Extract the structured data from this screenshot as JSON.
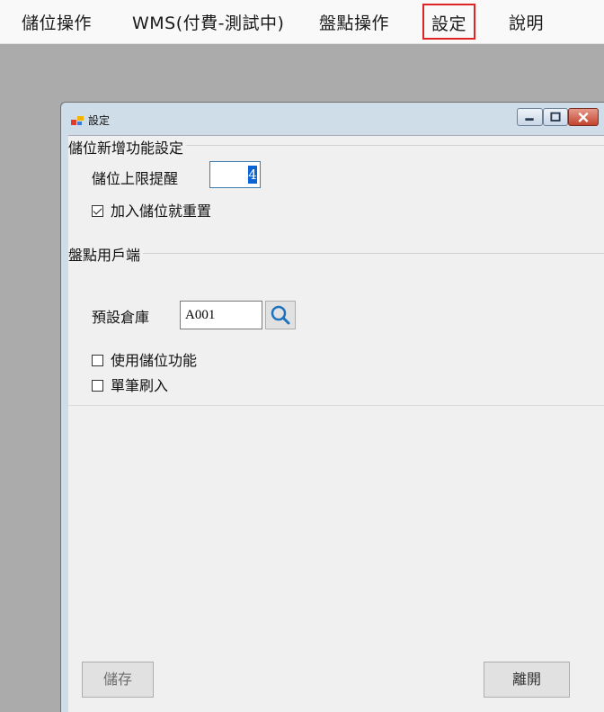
{
  "menubar": {
    "items": [
      {
        "label": "儲位操作"
      },
      {
        "label": "WMS(付費-測試中)"
      },
      {
        "label": "盤點操作"
      },
      {
        "label": "設定",
        "selected": true
      },
      {
        "label": "說明"
      }
    ]
  },
  "window": {
    "title": "設定",
    "icon": "app-icon",
    "controls": [
      "minimize-icon",
      "maximize-icon",
      "close-icon"
    ]
  },
  "storage_group": {
    "title": "儲位新增功能設定",
    "limit_label": "儲位上限提醒",
    "limit_value": "4",
    "reset_checkbox": {
      "label": "加入儲位就重置",
      "checked": true
    }
  },
  "client_group": {
    "title": "盤點用戶端",
    "warehouse_label": "預設倉庫",
    "warehouse_value": "A001",
    "search_icon": "search-icon",
    "use_location_checkbox": {
      "label": "使用儲位功能",
      "checked": false
    },
    "single_scan_checkbox": {
      "label": "單筆刷入",
      "checked": false
    }
  },
  "buttons": {
    "save_label": "儲存",
    "exit_label": "離開"
  },
  "colors": {
    "highlight_border": "#e02424",
    "selection": "#0a64d6",
    "search_icon": "#1e73be"
  }
}
